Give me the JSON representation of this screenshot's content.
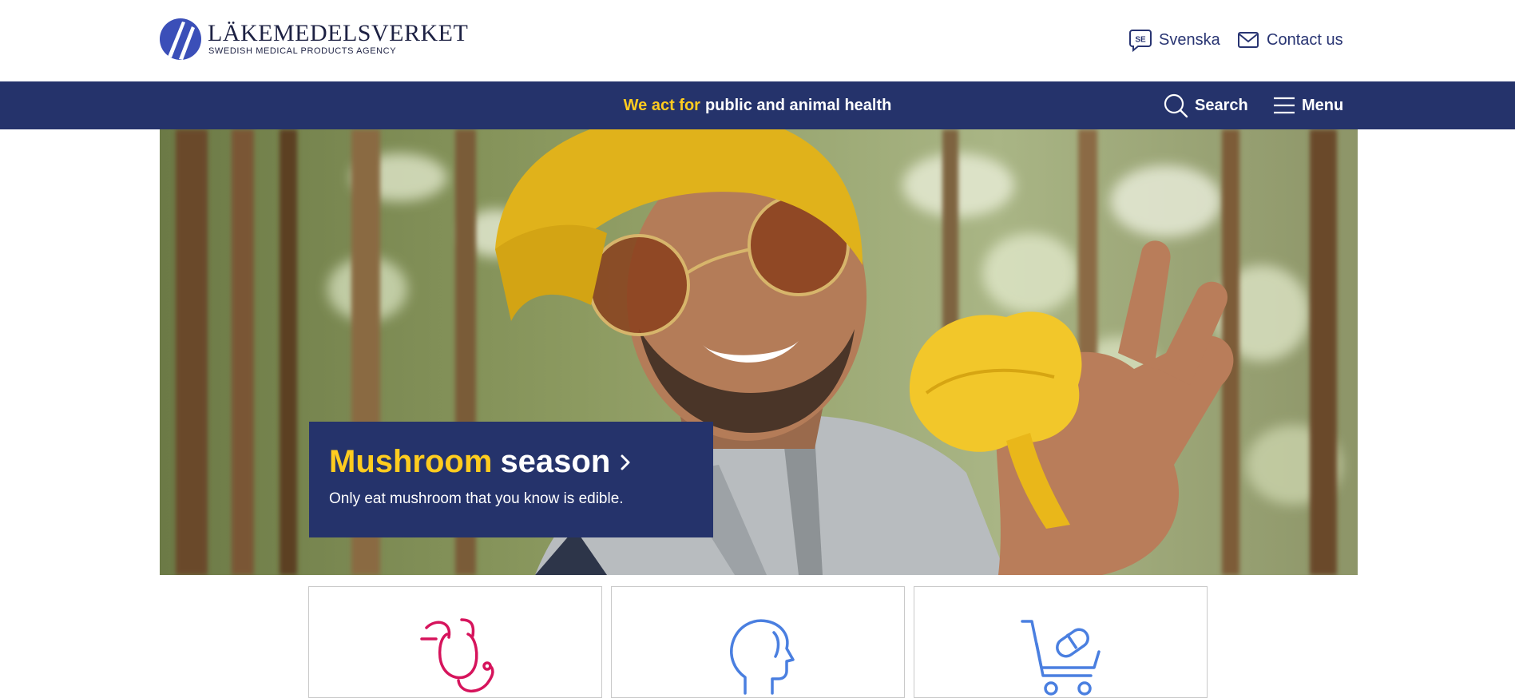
{
  "header": {
    "logo": {
      "name": "LÄKEMEDELSVERKET",
      "subtitle": "SWEDISH MEDICAL PRODUCTS AGENCY",
      "icon": "lakemedelsverket-logo-mark"
    },
    "language_link": {
      "label": "Svenska",
      "icon": "se-speech-bubble-icon",
      "icon_text": "SE"
    },
    "contact_link": {
      "label": "Contact us",
      "icon": "envelope-icon"
    }
  },
  "navbar": {
    "tagline_highlight": "We act for",
    "tagline_rest": "public and animal health",
    "search_label": "Search",
    "menu_label": "Menu"
  },
  "hero": {
    "image_alt": "Smiling man in a yellow beanie and sunglasses holding a chanterelle mushroom in a forest",
    "promo": {
      "title_highlight": "Mushroom",
      "title_rest": "season",
      "text": "Only eat mushroom that you know is edible."
    }
  },
  "cards": [
    {
      "icon": "stethoscope-icon"
    },
    {
      "icon": "head-profile-icon"
    },
    {
      "icon": "shopping-cart-pill-icon"
    }
  ],
  "colors": {
    "navy": "#25336b",
    "yellow": "#ffcc1f",
    "magenta": "#d6145c",
    "blue": "#4a7fe0"
  }
}
